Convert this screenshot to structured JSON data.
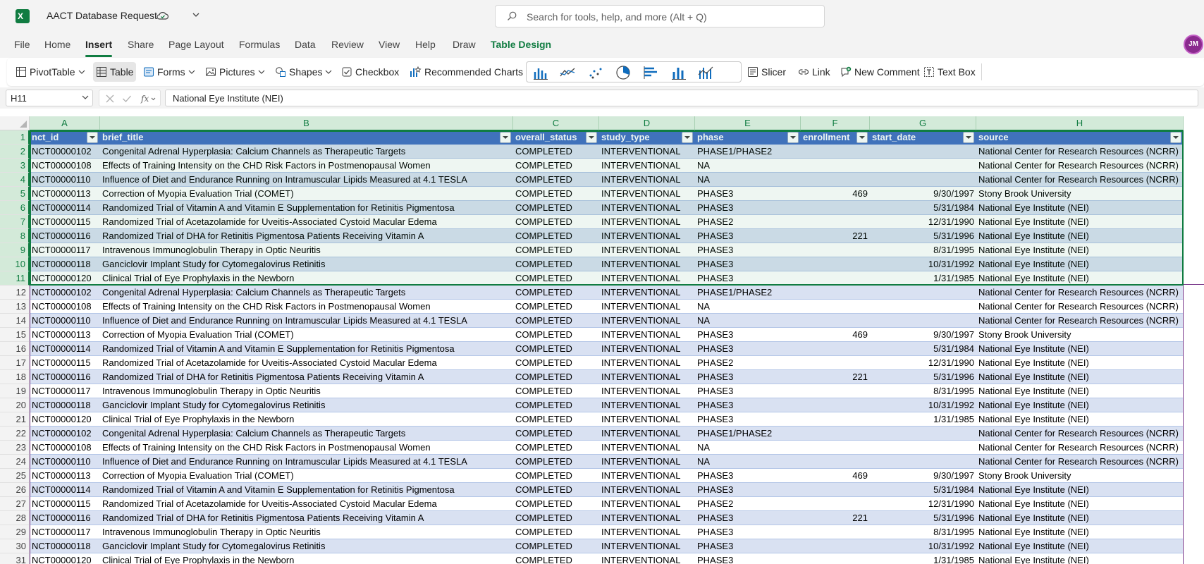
{
  "app": {
    "doc_title": "AACT Database Request",
    "search_placeholder": "Search for tools, help, and more (Alt + Q)",
    "avatar_initials": "JM",
    "brand_color": "#107c41"
  },
  "menu": {
    "items": [
      "File",
      "Home",
      "Insert",
      "Share",
      "Page Layout",
      "Formulas",
      "Data",
      "Review",
      "View",
      "Help",
      "Draw",
      "Table Design"
    ],
    "active": "Insert"
  },
  "ribbon": {
    "pivottable": "PivotTable",
    "table": "Table",
    "forms": "Forms",
    "pictures": "Pictures",
    "shapes": "Shapes",
    "checkbox": "Checkbox",
    "recommended_charts": "Recommended Charts",
    "slicer": "Slicer",
    "link": "Link",
    "new_comment": "New Comment",
    "text_box": "Text Box"
  },
  "formula_bar": {
    "name_box": "H11",
    "formula": "National Eye Institute (NEI)"
  },
  "sheet": {
    "column_letters": [
      "A",
      "B",
      "C",
      "D",
      "E",
      "F",
      "G",
      "H"
    ],
    "header": [
      "nct_id",
      "brief_title",
      "overall_status",
      "study_type",
      "phase",
      "enrollment",
      "start_date",
      "source"
    ],
    "rows": [
      [
        "NCT00000102",
        "Congenital Adrenal Hyperplasia: Calcium Channels as Therapeutic Targets",
        "COMPLETED",
        "INTERVENTIONAL",
        "PHASE1/PHASE2",
        "",
        "",
        "National Center for Research Resources (NCRR)"
      ],
      [
        "NCT00000108",
        "Effects of Training Intensity on the CHD Risk Factors in Postmenopausal Women",
        "COMPLETED",
        "INTERVENTIONAL",
        "NA",
        "",
        "",
        "National Center for Research Resources (NCRR)"
      ],
      [
        "NCT00000110",
        "Influence of Diet and Endurance Running on Intramuscular Lipids Measured at 4.1 TESLA",
        "COMPLETED",
        "INTERVENTIONAL",
        "NA",
        "",
        "",
        "National Center for Research Resources (NCRR)"
      ],
      [
        "NCT00000113",
        "Correction of Myopia Evaluation Trial (COMET)",
        "COMPLETED",
        "INTERVENTIONAL",
        "PHASE3",
        "469",
        "9/30/1997",
        "Stony Brook University"
      ],
      [
        "NCT00000114",
        "Randomized Trial of Vitamin A and Vitamin E Supplementation for Retinitis Pigmentosa",
        "COMPLETED",
        "INTERVENTIONAL",
        "PHASE3",
        "",
        "5/31/1984",
        "National Eye Institute (NEI)"
      ],
      [
        "NCT00000115",
        "Randomized Trial of Acetazolamide for Uveitis-Associated Cystoid Macular Edema",
        "COMPLETED",
        "INTERVENTIONAL",
        "PHASE2",
        "",
        "12/31/1990",
        "National Eye Institute (NEI)"
      ],
      [
        "NCT00000116",
        "Randomized Trial of DHA for Retinitis Pigmentosa Patients Receiving Vitamin A",
        "COMPLETED",
        "INTERVENTIONAL",
        "PHASE3",
        "221",
        "5/31/1996",
        "National Eye Institute (NEI)"
      ],
      [
        "NCT00000117",
        "Intravenous Immunoglobulin Therapy in Optic Neuritis",
        "COMPLETED",
        "INTERVENTIONAL",
        "PHASE3",
        "",
        "8/31/1995",
        "National Eye Institute (NEI)"
      ],
      [
        "NCT00000118",
        "Ganciclovir Implant Study for Cytomegalovirus Retinitis",
        "COMPLETED",
        "INTERVENTIONAL",
        "PHASE3",
        "",
        "10/31/1992",
        "National Eye Institute (NEI)"
      ],
      [
        "NCT00000120",
        "Clinical Trial of Eye Prophylaxis in the Newborn",
        "COMPLETED",
        "INTERVENTIONAL",
        "PHASE3",
        "",
        "1/31/1985",
        "National Eye Institute (NEI)"
      ],
      [
        "NCT00000102",
        "Congenital Adrenal Hyperplasia: Calcium Channels as Therapeutic Targets",
        "COMPLETED",
        "INTERVENTIONAL",
        "PHASE1/PHASE2",
        "",
        "",
        "National Center for Research Resources (NCRR)"
      ],
      [
        "NCT00000108",
        "Effects of Training Intensity on the CHD Risk Factors in Postmenopausal Women",
        "COMPLETED",
        "INTERVENTIONAL",
        "NA",
        "",
        "",
        "National Center for Research Resources (NCRR)"
      ],
      [
        "NCT00000110",
        "Influence of Diet and Endurance Running on Intramuscular Lipids Measured at 4.1 TESLA",
        "COMPLETED",
        "INTERVENTIONAL",
        "NA",
        "",
        "",
        "National Center for Research Resources (NCRR)"
      ],
      [
        "NCT00000113",
        "Correction of Myopia Evaluation Trial (COMET)",
        "COMPLETED",
        "INTERVENTIONAL",
        "PHASE3",
        "469",
        "9/30/1997",
        "Stony Brook University"
      ],
      [
        "NCT00000114",
        "Randomized Trial of Vitamin A and Vitamin E Supplementation for Retinitis Pigmentosa",
        "COMPLETED",
        "INTERVENTIONAL",
        "PHASE3",
        "",
        "5/31/1984",
        "National Eye Institute (NEI)"
      ],
      [
        "NCT00000115",
        "Randomized Trial of Acetazolamide for Uveitis-Associated Cystoid Macular Edema",
        "COMPLETED",
        "INTERVENTIONAL",
        "PHASE2",
        "",
        "12/31/1990",
        "National Eye Institute (NEI)"
      ],
      [
        "NCT00000116",
        "Randomized Trial of DHA for Retinitis Pigmentosa Patients Receiving Vitamin A",
        "COMPLETED",
        "INTERVENTIONAL",
        "PHASE3",
        "221",
        "5/31/1996",
        "National Eye Institute (NEI)"
      ],
      [
        "NCT00000117",
        "Intravenous Immunoglobulin Therapy in Optic Neuritis",
        "COMPLETED",
        "INTERVENTIONAL",
        "PHASE3",
        "",
        "8/31/1995",
        "National Eye Institute (NEI)"
      ],
      [
        "NCT00000118",
        "Ganciclovir Implant Study for Cytomegalovirus Retinitis",
        "COMPLETED",
        "INTERVENTIONAL",
        "PHASE3",
        "",
        "10/31/1992",
        "National Eye Institute (NEI)"
      ],
      [
        "NCT00000120",
        "Clinical Trial of Eye Prophylaxis in the Newborn",
        "COMPLETED",
        "INTERVENTIONAL",
        "PHASE3",
        "",
        "1/31/1985",
        "National Eye Institute (NEI)"
      ],
      [
        "NCT00000102",
        "Congenital Adrenal Hyperplasia: Calcium Channels as Therapeutic Targets",
        "COMPLETED",
        "INTERVENTIONAL",
        "PHASE1/PHASE2",
        "",
        "",
        "National Center for Research Resources (NCRR)"
      ],
      [
        "NCT00000108",
        "Effects of Training Intensity on the CHD Risk Factors in Postmenopausal Women",
        "COMPLETED",
        "INTERVENTIONAL",
        "NA",
        "",
        "",
        "National Center for Research Resources (NCRR)"
      ],
      [
        "NCT00000110",
        "Influence of Diet and Endurance Running on Intramuscular Lipids Measured at 4.1 TESLA",
        "COMPLETED",
        "INTERVENTIONAL",
        "NA",
        "",
        "",
        "National Center for Research Resources (NCRR)"
      ],
      [
        "NCT00000113",
        "Correction of Myopia Evaluation Trial (COMET)",
        "COMPLETED",
        "INTERVENTIONAL",
        "PHASE3",
        "469",
        "9/30/1997",
        "Stony Brook University"
      ],
      [
        "NCT00000114",
        "Randomized Trial of Vitamin A and Vitamin E Supplementation for Retinitis Pigmentosa",
        "COMPLETED",
        "INTERVENTIONAL",
        "PHASE3",
        "",
        "5/31/1984",
        "National Eye Institute (NEI)"
      ],
      [
        "NCT00000115",
        "Randomized Trial of Acetazolamide for Uveitis-Associated Cystoid Macular Edema",
        "COMPLETED",
        "INTERVENTIONAL",
        "PHASE2",
        "",
        "12/31/1990",
        "National Eye Institute (NEI)"
      ],
      [
        "NCT00000116",
        "Randomized Trial of DHA for Retinitis Pigmentosa Patients Receiving Vitamin A",
        "COMPLETED",
        "INTERVENTIONAL",
        "PHASE3",
        "221",
        "5/31/1996",
        "National Eye Institute (NEI)"
      ],
      [
        "NCT00000117",
        "Intravenous Immunoglobulin Therapy in Optic Neuritis",
        "COMPLETED",
        "INTERVENTIONAL",
        "PHASE3",
        "",
        "8/31/1995",
        "National Eye Institute (NEI)"
      ],
      [
        "NCT00000118",
        "Ganciclovir Implant Study for Cytomegalovirus Retinitis",
        "COMPLETED",
        "INTERVENTIONAL",
        "PHASE3",
        "",
        "10/31/1992",
        "National Eye Institute (NEI)"
      ],
      [
        "NCT00000120",
        "Clinical Trial of Eye Prophylaxis in the Newborn",
        "COMPLETED",
        "INTERVENTIONAL",
        "PHASE3",
        "",
        "1/31/1985",
        "National Eye Institute (NEI)"
      ]
    ],
    "selected_range_rows": [
      1,
      11
    ],
    "active_cell": "H11"
  }
}
